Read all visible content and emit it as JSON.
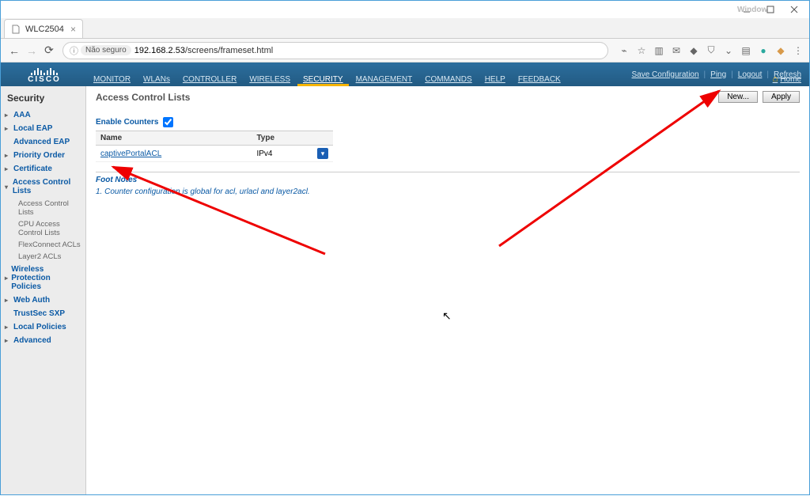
{
  "window": {
    "user_hint": "Window"
  },
  "browser": {
    "tab_title": "WLC2504",
    "insecure_label": "Não seguro",
    "url_host": "192.168.2.53",
    "url_path": "/screens/frameset.html"
  },
  "top_right": {
    "save": "Save Configuration",
    "ping": "Ping",
    "logout": "Logout",
    "refresh": "Refresh",
    "home": "Home"
  },
  "nav": {
    "items": [
      "MONITOR",
      "WLANs",
      "CONTROLLER",
      "WIRELESS",
      "SECURITY",
      "MANAGEMENT",
      "COMMANDS",
      "HELP",
      "FEEDBACK"
    ],
    "active_index": 4
  },
  "sidebar": {
    "title": "Security",
    "items": [
      {
        "label": "AAA",
        "type": "collapsible"
      },
      {
        "label": "Local EAP",
        "type": "collapsible"
      },
      {
        "label": "Advanced EAP",
        "type": "link"
      },
      {
        "label": "Priority Order",
        "type": "collapsible"
      },
      {
        "label": "Certificate",
        "type": "collapsible"
      },
      {
        "label": "Access Control Lists",
        "type": "collapsible",
        "expanded": true,
        "children": [
          {
            "label": "Access Control Lists"
          },
          {
            "label": "CPU Access Control Lists"
          },
          {
            "label": "FlexConnect ACLs"
          },
          {
            "label": "Layer2 ACLs"
          }
        ]
      },
      {
        "label": "Wireless Protection Policies",
        "type": "collapsible"
      },
      {
        "label": "Web Auth",
        "type": "collapsible"
      },
      {
        "label": "TrustSec SXP",
        "type": "link"
      },
      {
        "label": "Local Policies",
        "type": "collapsible"
      },
      {
        "label": "Advanced",
        "type": "collapsible"
      }
    ]
  },
  "content": {
    "title": "Access Control Lists",
    "btn_new": "New...",
    "btn_apply": "Apply",
    "enable_counters": "Enable Counters",
    "table": {
      "headers": [
        "Name",
        "Type"
      ],
      "rows": [
        {
          "name": "captivePortalACL",
          "type": "IPv4"
        }
      ]
    },
    "footnotes_title": "Foot Notes",
    "footnotes": [
      "1. Counter configuration is global for acl, urlacl and layer2acl."
    ]
  }
}
